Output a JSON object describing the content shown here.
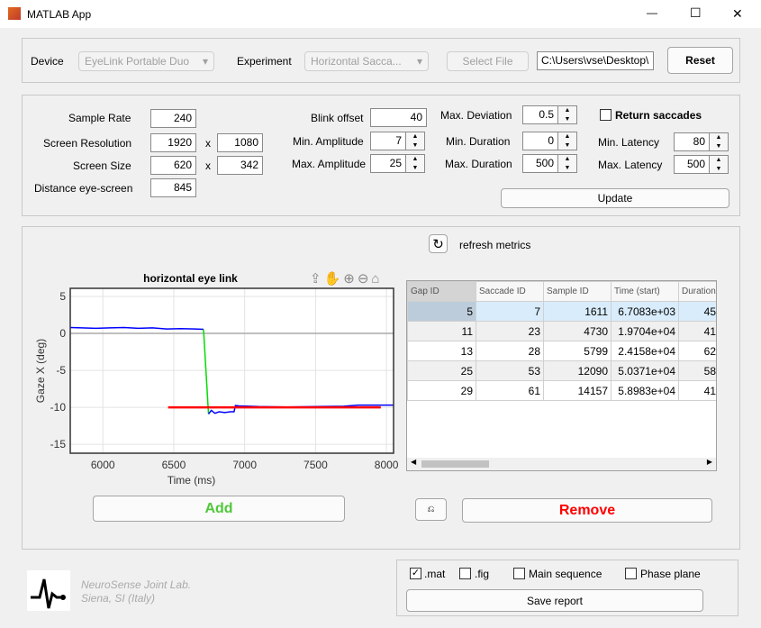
{
  "window": {
    "title": "MATLAB App",
    "minimize": "—",
    "maximize": "☐",
    "close": "✕"
  },
  "device": {
    "device_label": "Device",
    "device_value": "EyeLink Portable Duo",
    "experiment_label": "Experiment",
    "experiment_value": "Horizontal Sacca...",
    "select_file": "Select File",
    "file_path": "C:\\Users\\vse\\Desktop\\",
    "reset": "Reset"
  },
  "params": {
    "sample_rate_label": "Sample Rate",
    "sample_rate": "240",
    "screen_res_label": "Screen Resolution",
    "screen_res_w": "1920",
    "screen_res_h": "1080",
    "x1": "x",
    "screen_size_label": "Screen Size",
    "screen_size_w": "620",
    "screen_size_h": "342",
    "x2": "x",
    "distance_label": "Distance eye-screen",
    "distance": "845",
    "blink_offset_label": "Blink offset",
    "blink_offset": "40",
    "min_amp_label": "Min. Amplitude",
    "min_amp": "7",
    "max_amp_label": "Max. Amplitude",
    "max_amp": "25",
    "max_dev_label": "Max. Deviation",
    "max_dev": "0.5",
    "min_dur_label": "Min. Duration",
    "min_dur": "0",
    "max_dur_label": "Max. Duration",
    "max_dur": "500",
    "return_saccades_label": "Return saccades",
    "return_saccades": false,
    "min_lat_label": "Min. Latency",
    "min_lat": "80",
    "max_lat_label": "Max. Latency",
    "max_lat": "500",
    "update": "Update"
  },
  "main": {
    "refresh_label": "refresh metrics",
    "add": "Add",
    "remove": "Remove",
    "add_color": "#4fc83a",
    "remove_color": "#ff0000"
  },
  "table": {
    "columns": [
      "Gap ID",
      "Saccade ID",
      "Sample ID",
      "Time (start)",
      "Duration"
    ],
    "rows": [
      [
        "5",
        "7",
        "1611",
        "6.7083e+03",
        "45"
      ],
      [
        "11",
        "23",
        "4730",
        "1.9704e+04",
        "41"
      ],
      [
        "13",
        "28",
        "5799",
        "2.4158e+04",
        "62"
      ],
      [
        "25",
        "53",
        "12090",
        "5.0371e+04",
        "58"
      ],
      [
        "29",
        "61",
        "14157",
        "5.8983e+04",
        "41"
      ]
    ],
    "selected_row": 0
  },
  "footer": {
    "lab_line1": "NeuroSense Joint Lab.",
    "lab_line2": "Siena, SI (Italy)",
    "mat": ".mat",
    "mat_checked": true,
    "fig": ".fig",
    "fig_checked": false,
    "main_seq": "Main sequence",
    "main_seq_checked": false,
    "phase": "Phase plane",
    "phase_checked": false,
    "save": "Save report"
  },
  "chart_data": {
    "type": "line",
    "title": "horizontal eye link",
    "xlabel": "Time (ms)",
    "ylabel": "Gaze X (deg)",
    "xlim": [
      5770,
      8050
    ],
    "ylim": [
      -16.2,
      6.1
    ],
    "grid": true,
    "xticks": [
      6000,
      6500,
      7000,
      7500,
      8000
    ],
    "yticks": [
      5,
      0,
      -5,
      -10,
      -15
    ],
    "series": [
      {
        "color": "#0000ff",
        "x": [
          5770,
          5850,
          5950,
          6050,
          6150,
          6250,
          6350,
          6450,
          6550,
          6650,
          6710
        ],
        "y": [
          0.8,
          0.75,
          0.7,
          0.75,
          0.8,
          0.7,
          0.75,
          0.6,
          0.65,
          0.6,
          0.55
        ]
      },
      {
        "color": "#00dd00",
        "x": [
          6710,
          6745
        ],
        "y": [
          0.55,
          -10.9
        ]
      },
      {
        "color": "#0000ff",
        "x": [
          6745,
          6765,
          6790,
          6820,
          6860,
          6900,
          6925,
          6935,
          6960,
          7100,
          7300,
          7500,
          7700,
          7800,
          8050
        ],
        "y": [
          -10.9,
          -10.4,
          -10.8,
          -10.6,
          -10.7,
          -10.6,
          -10.6,
          -9.75,
          -9.8,
          -9.9,
          -9.95,
          -9.9,
          -9.85,
          -9.7,
          -9.7
        ]
      },
      {
        "color": "#ff0000",
        "x": [
          6460,
          7960
        ],
        "y": [
          -10,
          -10
        ]
      }
    ],
    "zero_line": 0
  }
}
